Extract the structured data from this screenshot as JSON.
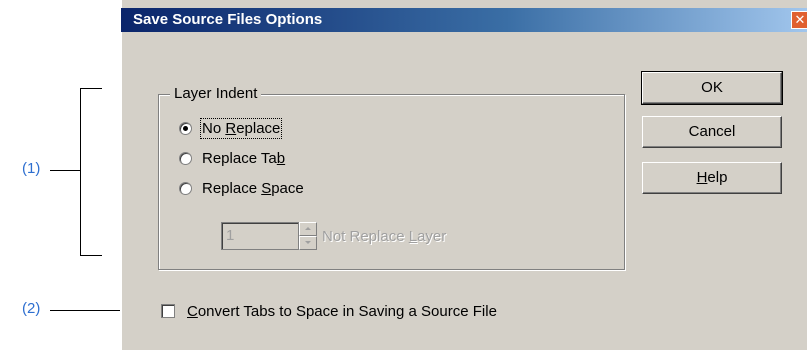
{
  "annotations": {
    "callout_1": "(1)",
    "callout_2": "(2)"
  },
  "dialog": {
    "title": "Save Source Files Options",
    "close_icon": "close-icon"
  },
  "layer_indent": {
    "group_title": "Layer Indent",
    "options": [
      {
        "label_pre": "No ",
        "label_u": "R",
        "label_post": "eplace",
        "checked": true
      },
      {
        "label_pre": "Replace Ta",
        "label_u": "b",
        "label_post": "",
        "checked": false
      },
      {
        "label_pre": "Replace ",
        "label_u": "S",
        "label_post": "pace",
        "checked": false
      }
    ],
    "spin_value": "1",
    "spin_label_pre": "Not Replace ",
    "spin_label_u": "L",
    "spin_label_post": "ayer"
  },
  "buttons": {
    "ok": "OK",
    "cancel": "Cancel",
    "help_u": "H",
    "help_post": "elp"
  },
  "checkbox": {
    "label_u": "C",
    "label_post": "onvert Tabs to Space in Saving a Source File",
    "checked": false
  },
  "colors": {
    "dialog_bg": "#d4d0c8",
    "callout_text": "#2e6fd0",
    "titlebar_start": "#0a246a"
  }
}
